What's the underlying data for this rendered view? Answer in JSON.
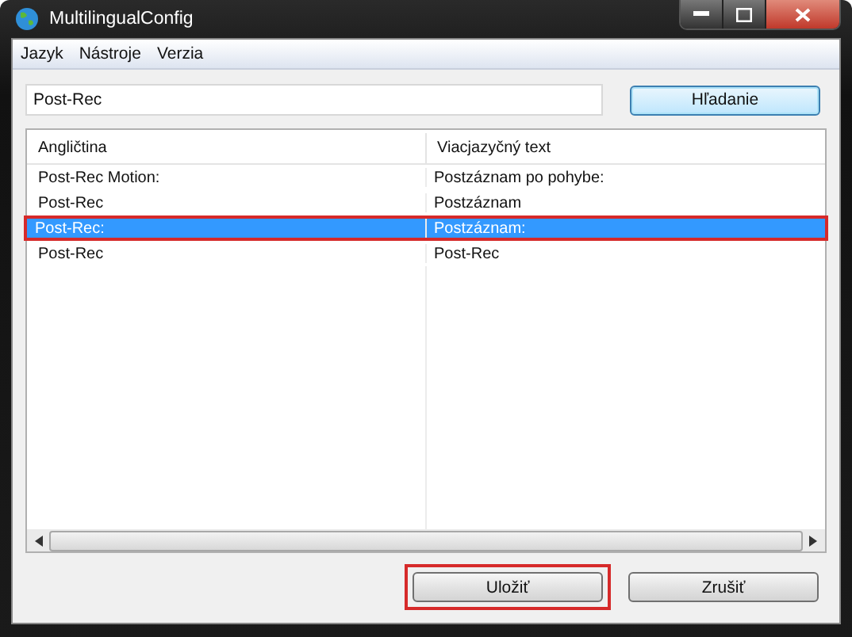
{
  "window": {
    "title": "MultilingualConfig"
  },
  "menu": [
    "Jazyk",
    "Nástroje",
    "Verzia"
  ],
  "search": {
    "value": "Post-Rec",
    "button": "Hľadanie"
  },
  "table": {
    "columns": [
      "Angličtina",
      "Viacjazyčný text"
    ],
    "rows": [
      {
        "cells": [
          "Post-Rec Motion:",
          "Postzáznam po pohybe:"
        ],
        "selected": false,
        "highlighted": false
      },
      {
        "cells": [
          "Post-Rec",
          "Postzáznam"
        ],
        "selected": false,
        "highlighted": false
      },
      {
        "cells": [
          "Post-Rec:",
          "Postzáznam:"
        ],
        "selected": true,
        "highlighted": true
      },
      {
        "cells": [
          "Post-Rec",
          "Post-Rec"
        ],
        "selected": false,
        "highlighted": false
      }
    ]
  },
  "buttons": [
    {
      "label": "Uložiť",
      "highlighted": true
    },
    {
      "label": "Zrušiť",
      "highlighted": false
    }
  ]
}
